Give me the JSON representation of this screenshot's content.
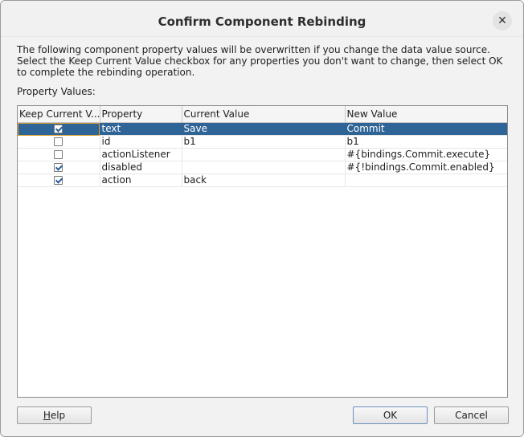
{
  "dialog": {
    "title": "Confirm Component Rebinding",
    "close_glyph": "✕",
    "description": "The following component property values will be overwritten if you change the data value source. Select the Keep Current Value checkbox for any properties you don't want to change, then select OK to complete the rebinding operation.",
    "property_values_label": "Property Values:"
  },
  "table": {
    "columns": [
      "Keep Current V...",
      "Property",
      "Current Value",
      "New Value"
    ],
    "rows": [
      {
        "keep": true,
        "property": "text",
        "current": "Save",
        "new": "Commit",
        "selected": true
      },
      {
        "keep": false,
        "property": "id",
        "current": "b1",
        "new": "b1",
        "selected": false
      },
      {
        "keep": false,
        "property": "actionListener",
        "current": "",
        "new": "#{bindings.Commit.execute}",
        "selected": false
      },
      {
        "keep": true,
        "property": "disabled",
        "current": "",
        "new": "#{!bindings.Commit.enabled}",
        "selected": false
      },
      {
        "keep": true,
        "property": "action",
        "current": "back",
        "new": "",
        "selected": false
      }
    ]
  },
  "buttons": {
    "help_label_prefix": "",
    "help_label_mnemonic": "H",
    "help_label_rest": "elp",
    "ok_label": "OK",
    "cancel_label": "Cancel"
  },
  "colors": {
    "selection": "#2f6496",
    "focus_outline": "#e0a030"
  }
}
